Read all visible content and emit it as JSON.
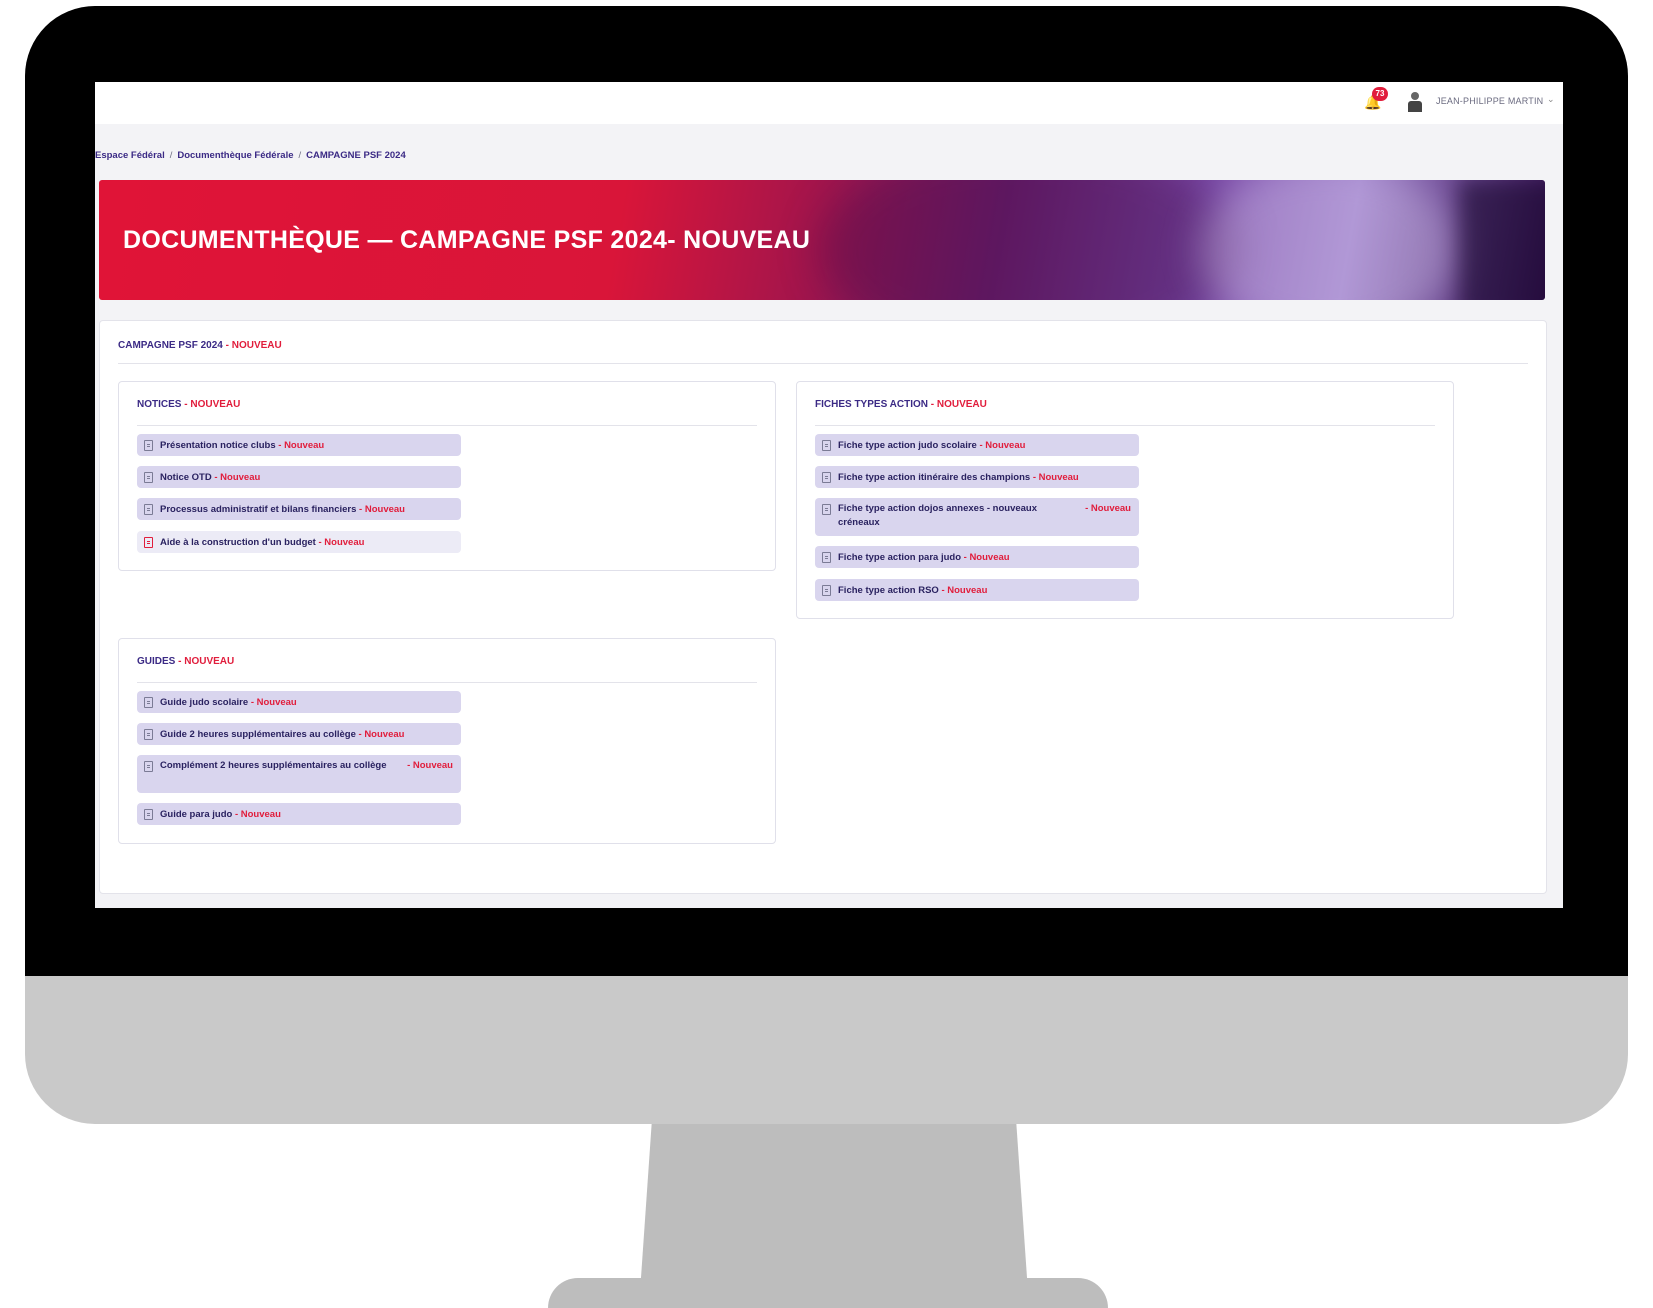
{
  "topbar": {
    "notification_count": "73",
    "username": "JEAN-PHILIPPE MARTIN"
  },
  "breadcrumb": [
    "Espace Fédéral",
    "Documenthèque Fédérale",
    "CAMPAGNE PSF 2024"
  ],
  "hero": {
    "title": "DOCUMENTHÈQUE — CAMPAGNE PSF 2024- NOUVEAU"
  },
  "main": {
    "heading": "CAMPAGNE PSF 2024",
    "heading_tag": "- NOUVEAU",
    "sections": {
      "notices": {
        "title": "NOTICES",
        "tag": "- NOUVEAU",
        "items": [
          {
            "label": "Présentation notice clubs",
            "tag": "- Nouveau"
          },
          {
            "label": "Notice OTD",
            "tag": "- Nouveau"
          },
          {
            "label": "Processus administratif et bilans financiers",
            "tag": "- Nouveau"
          },
          {
            "label": "Aide à la construction d'un budget",
            "tag": "- Nouveau"
          }
        ]
      },
      "fiches": {
        "title": "FICHES TYPES ACTION",
        "tag": "- NOUVEAU",
        "items": [
          {
            "label": "Fiche type action judo scolaire",
            "tag": "- Nouveau"
          },
          {
            "label": "Fiche type action itinéraire des champions",
            "tag": "- Nouveau"
          },
          {
            "label": "Fiche type action dojos annexes - nouveaux créneaux",
            "tag": "- Nouveau"
          },
          {
            "label": "Fiche type action para judo",
            "tag": "- Nouveau"
          },
          {
            "label": "Fiche type action RSO",
            "tag": "- Nouveau"
          }
        ]
      },
      "guides": {
        "title": "GUIDES",
        "tag": "- NOUVEAU",
        "items": [
          {
            "label": "Guide judo scolaire",
            "tag": "- Nouveau"
          },
          {
            "label": "Guide 2 heures supplémentaires au collège",
            "tag": "- Nouveau"
          },
          {
            "label": "Complément 2 heures supplémentaires au collège",
            "tag": "- Nouveau"
          },
          {
            "label": "Guide para judo",
            "tag": "- Nouveau"
          }
        ]
      }
    }
  },
  "colors": {
    "brand_red": "#e11d3c",
    "brand_purple": "#3b2a85",
    "item_bg": "#d9d5ee"
  }
}
